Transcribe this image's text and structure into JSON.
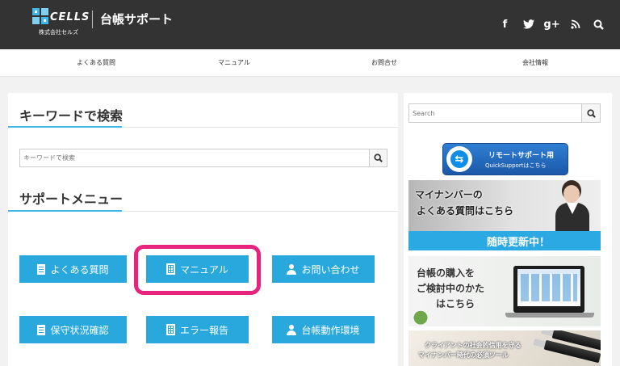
{
  "header": {
    "logo_word": "CELLS",
    "logo_company": "株式会社セルズ",
    "site_title": "台帳サポート",
    "social_icons": [
      "facebook-icon",
      "twitter-icon",
      "google-plus-icon",
      "rss-icon",
      "search-icon"
    ],
    "social_glyphs": {
      "facebook": "f",
      "twitter": "🐦",
      "google_plus": "g+",
      "rss": "))",
      "search": "🔍"
    }
  },
  "nav": {
    "items": [
      "よくある質問",
      "マニュアル",
      "お問合せ",
      "会社情報"
    ]
  },
  "main": {
    "keyword_title": "キーワードで検索",
    "search_placeholder": "キーワードで検索",
    "support_title": "サポートメニュー",
    "buttons": [
      {
        "label": "よくある質問",
        "icon": "document-icon"
      },
      {
        "label": "マニュアル",
        "icon": "building-icon"
      },
      {
        "label": "お問い合わせ",
        "icon": "user-icon"
      },
      {
        "label": "保守状況確認",
        "icon": "document-icon"
      },
      {
        "label": "エラー報告",
        "icon": "building-icon"
      },
      {
        "label": "台帳動作環境",
        "icon": "user-icon"
      }
    ],
    "highlight_color": "#e6237d",
    "accent_color": "#29a8de"
  },
  "sidebar": {
    "search_placeholder": "Search",
    "quicksupport": {
      "line1": "リモートサポート用",
      "line2": "QuickSupportはこちら"
    },
    "mynumber": {
      "line1": "マイナンバーの",
      "line2": "よくある質問はこちら",
      "bar": "随時更新中！"
    },
    "ledger": {
      "line1": "台帳の購入を",
      "line2": "ご検討中のかた",
      "line3": "はこちら"
    },
    "usb": {
      "line1": "クライアントの社会的信用を守る",
      "line2": "マイナンバー時代の必須ツール"
    }
  }
}
